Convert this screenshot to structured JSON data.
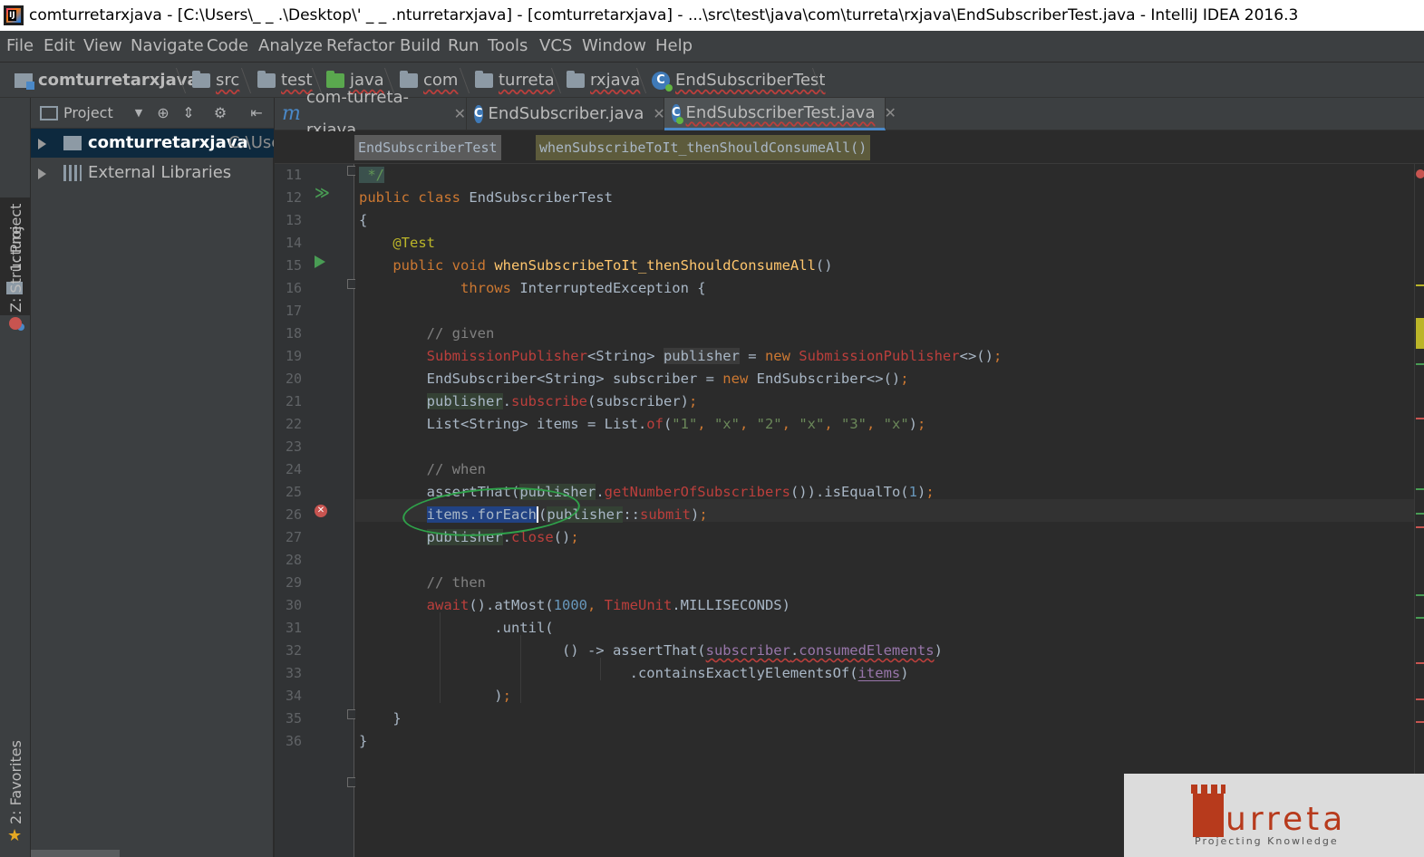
{
  "window": {
    "title": "comturretarxjava - [C:\\Users\\_   _     .\\Desktop\\'    _         _                    .nturretarxjava] - [comturretarxjava] - ...\\src\\test\\java\\com\\turreta\\rxjava\\EndSubscriberTest.java - IntelliJ IDEA 2016.3"
  },
  "menu": [
    "File",
    "Edit",
    "View",
    "Navigate",
    "Code",
    "Analyze",
    "Refactor",
    "Build",
    "Run",
    "Tools",
    "VCS",
    "Window",
    "Help"
  ],
  "breadcrumb": [
    "comturretarxjava",
    "src",
    "test",
    "java",
    "com",
    "turreta",
    "rxjava",
    "EndSubscriberTest"
  ],
  "tool_windows": {
    "project_tab": "1: Project",
    "structure_tab": "Z: Structure",
    "favorites_tab": "2: Favorites"
  },
  "project_panel": {
    "title": "Project",
    "root_label": "comturretarxjava",
    "root_path": "C:\\Use",
    "libraries_label": "External Libraries"
  },
  "editor_tabs": [
    {
      "icon": "module-icon",
      "label": "com-turreta-rxjava",
      "active": false
    },
    {
      "icon": "class-icon",
      "label": "EndSubscriber.java",
      "active": false
    },
    {
      "icon": "test-class-icon",
      "label": "EndSubscriberTest.java",
      "active": true
    }
  ],
  "editor_breadcrumb": {
    "class": "EndSubscriberTest",
    "method": "whenSubscribeToIt_thenShouldConsumeAll()"
  },
  "line_numbers": [
    "11",
    "12",
    "13",
    "14",
    "15",
    "16",
    "17",
    "18",
    "19",
    "20",
    "21",
    "22",
    "23",
    "24",
    "25",
    "26",
    "27",
    "28",
    "29",
    "30",
    "31",
    "32",
    "33",
    "34",
    "35",
    "36"
  ],
  "code_lines": [
    [
      {
        "t": " */",
        "c": "dochl"
      }
    ],
    [
      {
        "t": "public class ",
        "c": "kw"
      },
      {
        "t": "EndSubscriberTest"
      }
    ],
    [
      {
        "t": "{"
      }
    ],
    [
      {
        "t": "    "
      },
      {
        "t": "@Test",
        "c": "ann"
      }
    ],
    [
      {
        "t": "    "
      },
      {
        "t": "public void ",
        "c": "kw"
      },
      {
        "t": "whenSubscribeToIt_thenShouldConsumeAll",
        "c": "fn"
      },
      {
        "t": "()"
      }
    ],
    [
      {
        "t": "            "
      },
      {
        "t": "throws ",
        "c": "kw"
      },
      {
        "t": "InterruptedException {"
      }
    ],
    [],
    [
      {
        "t": "        "
      },
      {
        "t": "// given",
        "c": "cm"
      }
    ],
    [
      {
        "t": "        "
      },
      {
        "t": "SubmissionPublisher",
        "c": "err"
      },
      {
        "t": "<String> "
      },
      {
        "t": "publisher",
        "c": "warnbg"
      },
      {
        "t": " = "
      },
      {
        "t": "new ",
        "c": "kw"
      },
      {
        "t": "SubmissionPublisher",
        "c": "err"
      },
      {
        "t": "<>()"
      },
      {
        "t": ";",
        "c": "kw"
      }
    ],
    [
      {
        "t": "        EndSubscriber<String> subscriber = "
      },
      {
        "t": "new ",
        "c": "kw"
      },
      {
        "t": "EndSubscriber<>()"
      },
      {
        "t": ";",
        "c": "kw"
      }
    ],
    [
      {
        "t": "        "
      },
      {
        "t": "publisher",
        "c": "hl"
      },
      {
        "t": "."
      },
      {
        "t": "subscribe",
        "c": "err"
      },
      {
        "t": "(subscriber)"
      },
      {
        "t": ";",
        "c": "kw"
      }
    ],
    [
      {
        "t": "        List<String> items = List."
      },
      {
        "t": "of",
        "c": "err"
      },
      {
        "t": "("
      },
      {
        "t": "\"1\"",
        "c": "st"
      },
      {
        "t": ", ",
        "c": "kw"
      },
      {
        "t": "\"x\"",
        "c": "st"
      },
      {
        "t": ", ",
        "c": "kw"
      },
      {
        "t": "\"2\"",
        "c": "st"
      },
      {
        "t": ", ",
        "c": "kw"
      },
      {
        "t": "\"x\"",
        "c": "st"
      },
      {
        "t": ", ",
        "c": "kw"
      },
      {
        "t": "\"3\"",
        "c": "st"
      },
      {
        "t": ", ",
        "c": "kw"
      },
      {
        "t": "\"x\"",
        "c": "st"
      },
      {
        "t": ")"
      },
      {
        "t": ";",
        "c": "kw"
      }
    ],
    [],
    [
      {
        "t": "        "
      },
      {
        "t": "// when",
        "c": "cm"
      }
    ],
    [
      {
        "t": "        assertThat("
      },
      {
        "t": "publisher",
        "c": "hl"
      },
      {
        "t": "."
      },
      {
        "t": "getNumberOfSubscribers",
        "c": "err"
      },
      {
        "t": "()).isEqualTo("
      },
      {
        "t": "1",
        "c": "nm"
      },
      {
        "t": ")"
      },
      {
        "t": ";",
        "c": "kw"
      }
    ],
    [
      {
        "t": "        "
      },
      {
        "t": "items.forEach",
        "c": "sel"
      },
      {
        "t": "(",
        "c": "caret"
      },
      {
        "t": "publisher",
        "c": "hl"
      },
      {
        "t": "::"
      },
      {
        "t": "submit",
        "c": "err"
      },
      {
        "t": ")"
      },
      {
        "t": ";",
        "c": "kw"
      }
    ],
    [
      {
        "t": "        "
      },
      {
        "t": "publisher",
        "c": "hl"
      },
      {
        "t": "."
      },
      {
        "t": "close",
        "c": "err"
      },
      {
        "t": "()"
      },
      {
        "t": ";",
        "c": "kw"
      }
    ],
    [],
    [
      {
        "t": "        "
      },
      {
        "t": "// then",
        "c": "cm"
      }
    ],
    [
      {
        "t": "        "
      },
      {
        "t": "await",
        "c": "err"
      },
      {
        "t": "().atMost("
      },
      {
        "t": "1000",
        "c": "nm"
      },
      {
        "t": ", ",
        "c": "kw"
      },
      {
        "t": "TimeUnit",
        "c": "err"
      },
      {
        "t": ".MILLISECONDS)"
      }
    ],
    [
      {
        "t": "                .until("
      }
    ],
    [
      {
        "t": "                        () -> assertThat("
      },
      {
        "t": "subscriber",
        "c": "fld und"
      },
      {
        "t": ".",
        "c": "und"
      },
      {
        "t": "consumedElements",
        "c": "fld und"
      },
      {
        "t": ")"
      }
    ],
    [
      {
        "t": "                                .containsExactlyElementsOf("
      },
      {
        "t": "items",
        "c": "fld undl"
      },
      {
        "t": ")"
      }
    ],
    [
      {
        "t": "                )"
      },
      {
        "t": ";",
        "c": "kw"
      }
    ],
    [
      {
        "t": "    }"
      }
    ],
    [
      {
        "t": "}"
      }
    ]
  ],
  "watermark": {
    "brand": "urreta",
    "tagline": "Projecting Knowledge"
  },
  "colors": {
    "editor_bg": "#2b2b2b",
    "keyword": "#cc7832",
    "annotation": "#bbb529",
    "method_decl": "#ffc66d",
    "error": "#bc3f3c",
    "selection": "#214283",
    "brand_red": "#b73a1c"
  }
}
